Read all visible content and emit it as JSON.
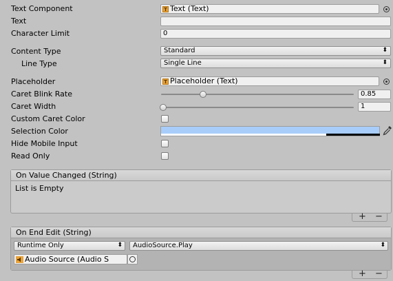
{
  "inspector": {
    "labels": {
      "text_component": "Text Component",
      "text": "Text",
      "character_limit": "Character Limit",
      "content_type": "Content Type",
      "line_type": "Line Type",
      "placeholder": "Placeholder",
      "caret_blink_rate": "Caret Blink Rate",
      "caret_width": "Caret Width",
      "custom_caret_color": "Custom Caret Color",
      "selection_color": "Selection Color",
      "hide_mobile_input": "Hide Mobile Input",
      "read_only": "Read Only"
    },
    "values": {
      "text_component": "Text (Text)",
      "text": "",
      "character_limit": "0",
      "content_type": "Standard",
      "line_type": "Single Line",
      "placeholder": "Placeholder (Text)",
      "caret_blink_rate": "0.85",
      "caret_width": "1"
    },
    "colors": {
      "selection_color": "#a8cdfa"
    },
    "icons": {
      "text_component": "T",
      "placeholder": "T"
    }
  },
  "on_value_changed": {
    "title": "On Value Changed (String)",
    "empty_text": "List is Empty",
    "add": "+",
    "remove": "−"
  },
  "on_end_edit": {
    "title": "On End Edit (String)",
    "runtime": "Runtime Only",
    "function": "AudioSource.Play",
    "target": "Audio Source (Audio S",
    "add": "+",
    "remove": "−"
  }
}
